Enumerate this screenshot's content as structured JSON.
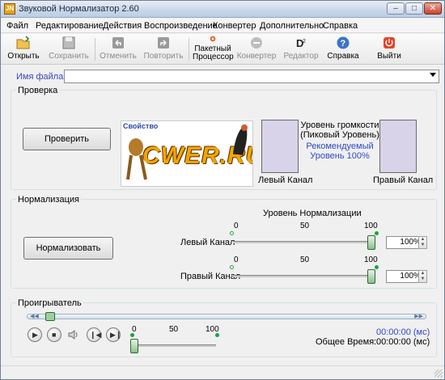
{
  "window": {
    "title": "Звуковой Нормализатор 2.60",
    "icon": "JN"
  },
  "menu": [
    "Файл",
    "Редактирование",
    "Действия",
    "Воспроизведение",
    "Конвертер",
    "Дополнительно",
    "Справка"
  ],
  "toolbar": {
    "open": "Открыть",
    "save": "Сохранить",
    "undo": "Отменить",
    "redo": "Повторить",
    "batch_line1": "Пакетный",
    "batch_line2": "Процессор",
    "convert": "Конвертер",
    "editor": "Редактор",
    "help": "Справка",
    "exit": "Выйти"
  },
  "file": {
    "label": "Имя файла:",
    "value": ""
  },
  "check": {
    "title": "Проверка",
    "button": "Проверить",
    "logo_caption": "Свойство",
    "logo_text": "CWER.RU",
    "volume_line1": "Уровень громкости",
    "volume_line2": "(Пиковый Уровень)",
    "recommended_line1": "Рекомендуемый",
    "recommended_line2": "Уровень 100%",
    "left_channel": "Левый Канал",
    "right_channel": "Правый Канал"
  },
  "normalize": {
    "title": "Нормализация",
    "button": "Нормализовать",
    "level_label": "Уровень Нормализации",
    "ticks": [
      "0",
      "50",
      "100"
    ],
    "left_label": "Левый Канал",
    "left_value": "100%",
    "left_level": 100,
    "right_label": "Правый Канал",
    "right_value": "100%",
    "right_level": 100
  },
  "player": {
    "title": "Проигрыватель",
    "volume_ticks": [
      "0",
      "50",
      "100"
    ],
    "volume_level": 0,
    "position": "00:00:00 (мс)",
    "total_label": "Общее Время:",
    "total": "00:00:00 (мс)"
  }
}
